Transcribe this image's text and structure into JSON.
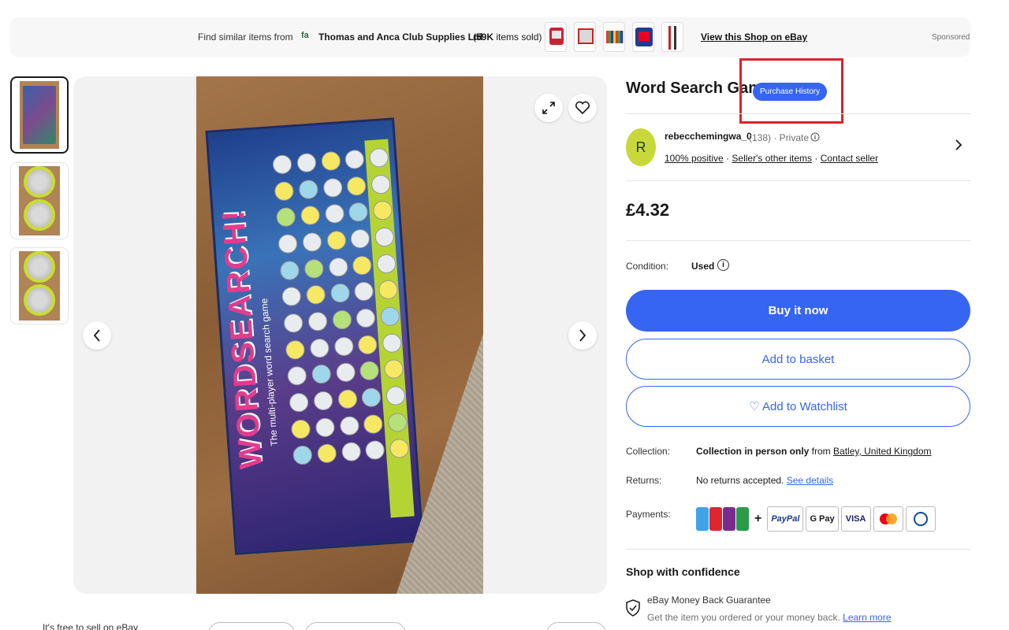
{
  "banner": {
    "find_label": "Find similar items from",
    "shop_logo": "fa",
    "shop_name": "Thomas and Anca Club Supplies Ltd",
    "items_sold": "59K",
    "items_sold_suffix": " items sold)",
    "items_sold_prefix": "(",
    "view_shop": "View this Shop on eBay",
    "sponsored": "Sponsored"
  },
  "gallery": {
    "box_title": "WORDSEARCH!",
    "box_subtitle": "The multi-player word search game",
    "icons": {
      "expand": "expand-icon",
      "favourite": "heart-icon",
      "prev": "chevron-left-icon",
      "next": "chevron-right-icon"
    }
  },
  "item": {
    "title": "Word Search Game",
    "purchase_history_badge": "Purchase History",
    "price": "£4.32",
    "condition_label": "Condition:",
    "condition_value": "Used"
  },
  "seller": {
    "initial": "R",
    "name": "rebecchemingwa_0",
    "feedback_count": "(138) · Private",
    "positive": "100% positive",
    "other_items": "Seller's other items",
    "contact": "Contact seller",
    "sep": " · "
  },
  "actions": {
    "buy_now": "Buy it now",
    "add_basket": "Add to basket",
    "add_watchlist": "♡ Add to Watchlist"
  },
  "details": {
    "collection_label": "Collection:",
    "collection_bold": "Collection in person only",
    "collection_from": " from ",
    "collection_location": "Batley, United Kingdom",
    "returns_label": "Returns:",
    "returns_value": "No returns accepted.",
    "returns_link": "See details",
    "payments_label": "Payments:",
    "payment_methods": [
      "PayPal",
      "G Pay",
      "VISA"
    ]
  },
  "confidence": {
    "heading": "Shop with confidence",
    "guarantee_title": "eBay Money Back Guarantee",
    "guarantee_text": "Get the item you ordered or your money back.",
    "learn_more": "Learn more"
  },
  "footer": {
    "free_sell": "It's free to sell on eBay"
  },
  "colors": {
    "accent": "#3665f3",
    "highlight_box": "#d8242c",
    "avatar": "#c8d83a"
  }
}
